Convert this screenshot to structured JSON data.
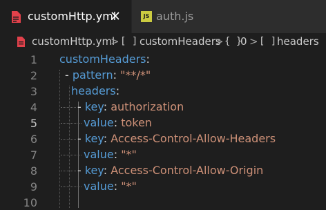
{
  "tabs": [
    {
      "label": "customHttp.yml",
      "close_icon": "close-icon",
      "icon": "yaml-file-icon"
    },
    {
      "label": "auth.js",
      "icon": "js-file-icon",
      "icon_text": "JS"
    }
  ],
  "breadcrumb": {
    "file": "customHttp.yml",
    "items": [
      {
        "glyph": "[ ]",
        "label": "customHeaders"
      },
      {
        "glyph": "{ }",
        "label": "0"
      },
      {
        "glyph": "[ ]",
        "label": "headers"
      }
    ],
    "separator": ">"
  },
  "editor": {
    "current_line": 5,
    "lines": [
      {
        "num": "1",
        "key": "customHeaders",
        "colon": ":"
      },
      {
        "num": "2",
        "dash": "- ",
        "key": "pattern",
        "colon": ": ",
        "value": "\"**/*\""
      },
      {
        "num": "3",
        "key": "headers",
        "colon": ":"
      },
      {
        "num": "4",
        "dash": "- ",
        "key": "key",
        "colon": ": ",
        "value": "authorization"
      },
      {
        "num": "5",
        "key": "value",
        "colon": ": ",
        "value": "token"
      },
      {
        "num": "6",
        "dash": "- ",
        "key": "key",
        "colon": ": ",
        "value": "Access-Control-Allow-Headers"
      },
      {
        "num": "7",
        "key": "value",
        "colon": ": ",
        "value": "\"*\""
      },
      {
        "num": "8",
        "dash": "- ",
        "key": "key",
        "colon": ": ",
        "value": "Access-Control-Allow-Origin"
      },
      {
        "num": "9",
        "key": "value",
        "colon": ": ",
        "value": "\"*\""
      },
      {
        "num": "10"
      }
    ]
  },
  "colors": {
    "yaml_icon": "#e2414b",
    "key": "#569cd6",
    "string": "#ce9178",
    "js_icon": "#cbcb41"
  }
}
